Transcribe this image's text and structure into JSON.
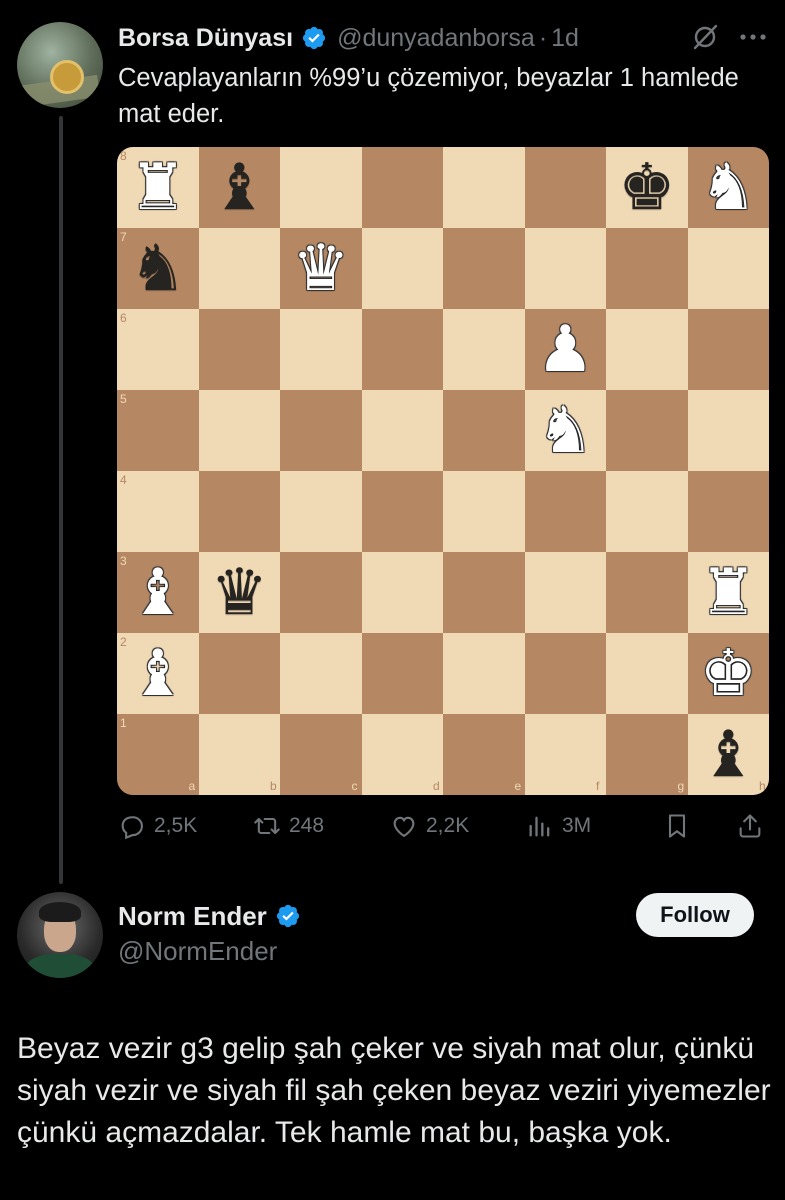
{
  "tweet": {
    "author_name": "Borsa Dünyası",
    "handle": "@dunyadanborsa",
    "separator": "·",
    "time": "1d",
    "text": "Cevaplayanların %99’u çözemiyor, beyazlar 1 hamlede mat eder.",
    "verified_color": "#1d9bf0",
    "board": {
      "light_color": "#f0d9b5",
      "dark_color": "#b58863",
      "rank_labels": [
        "8",
        "7",
        "6",
        "5",
        "4",
        "3",
        "2",
        "1"
      ],
      "file_labels": [
        "a",
        "b",
        "c",
        "d",
        "e",
        "f",
        "g",
        "h"
      ],
      "pieces": [
        {
          "square": "a8",
          "symbol": "♜",
          "side": "white",
          "name": "white-rook"
        },
        {
          "square": "b8",
          "symbol": "♝",
          "side": "black",
          "name": "black-bishop"
        },
        {
          "square": "g8",
          "symbol": "♚",
          "side": "black",
          "name": "black-king"
        },
        {
          "square": "h8",
          "symbol": "♞",
          "side": "white",
          "name": "white-knight"
        },
        {
          "square": "a7",
          "symbol": "♞",
          "side": "black",
          "name": "black-knight"
        },
        {
          "square": "c7",
          "symbol": "♛",
          "side": "white",
          "name": "white-queen"
        },
        {
          "square": "f6",
          "symbol": "♟",
          "side": "white",
          "name": "white-pawn"
        },
        {
          "square": "f5",
          "symbol": "♞",
          "side": "white",
          "name": "white-knight"
        },
        {
          "square": "a3",
          "symbol": "♝",
          "side": "white",
          "name": "white-bishop"
        },
        {
          "square": "b3",
          "symbol": "♛",
          "side": "black",
          "name": "black-queen"
        },
        {
          "square": "h3",
          "symbol": "♜",
          "side": "white",
          "name": "white-rook"
        },
        {
          "square": "a2",
          "symbol": "♝",
          "side": "white",
          "name": "white-bishop"
        },
        {
          "square": "h2",
          "symbol": "♚",
          "side": "white",
          "name": "white-king"
        },
        {
          "square": "h1",
          "symbol": "♝",
          "side": "black",
          "name": "black-bishop"
        }
      ]
    },
    "actions": {
      "replies": "2,5K",
      "reposts": "248",
      "likes": "2,2K",
      "views": "3M"
    }
  },
  "reply": {
    "author_name": "Norm Ender",
    "handle": "@NormEnder",
    "follow_label": "Follow",
    "text": "Beyaz vezir g3 gelip şah çeker ve siyah mat olur, çünkü siyah vezir ve siyah fil şah çeken beyaz veziri yiyemezler çünkü açmazdalar. Tek hamle mat bu, başka yok."
  }
}
